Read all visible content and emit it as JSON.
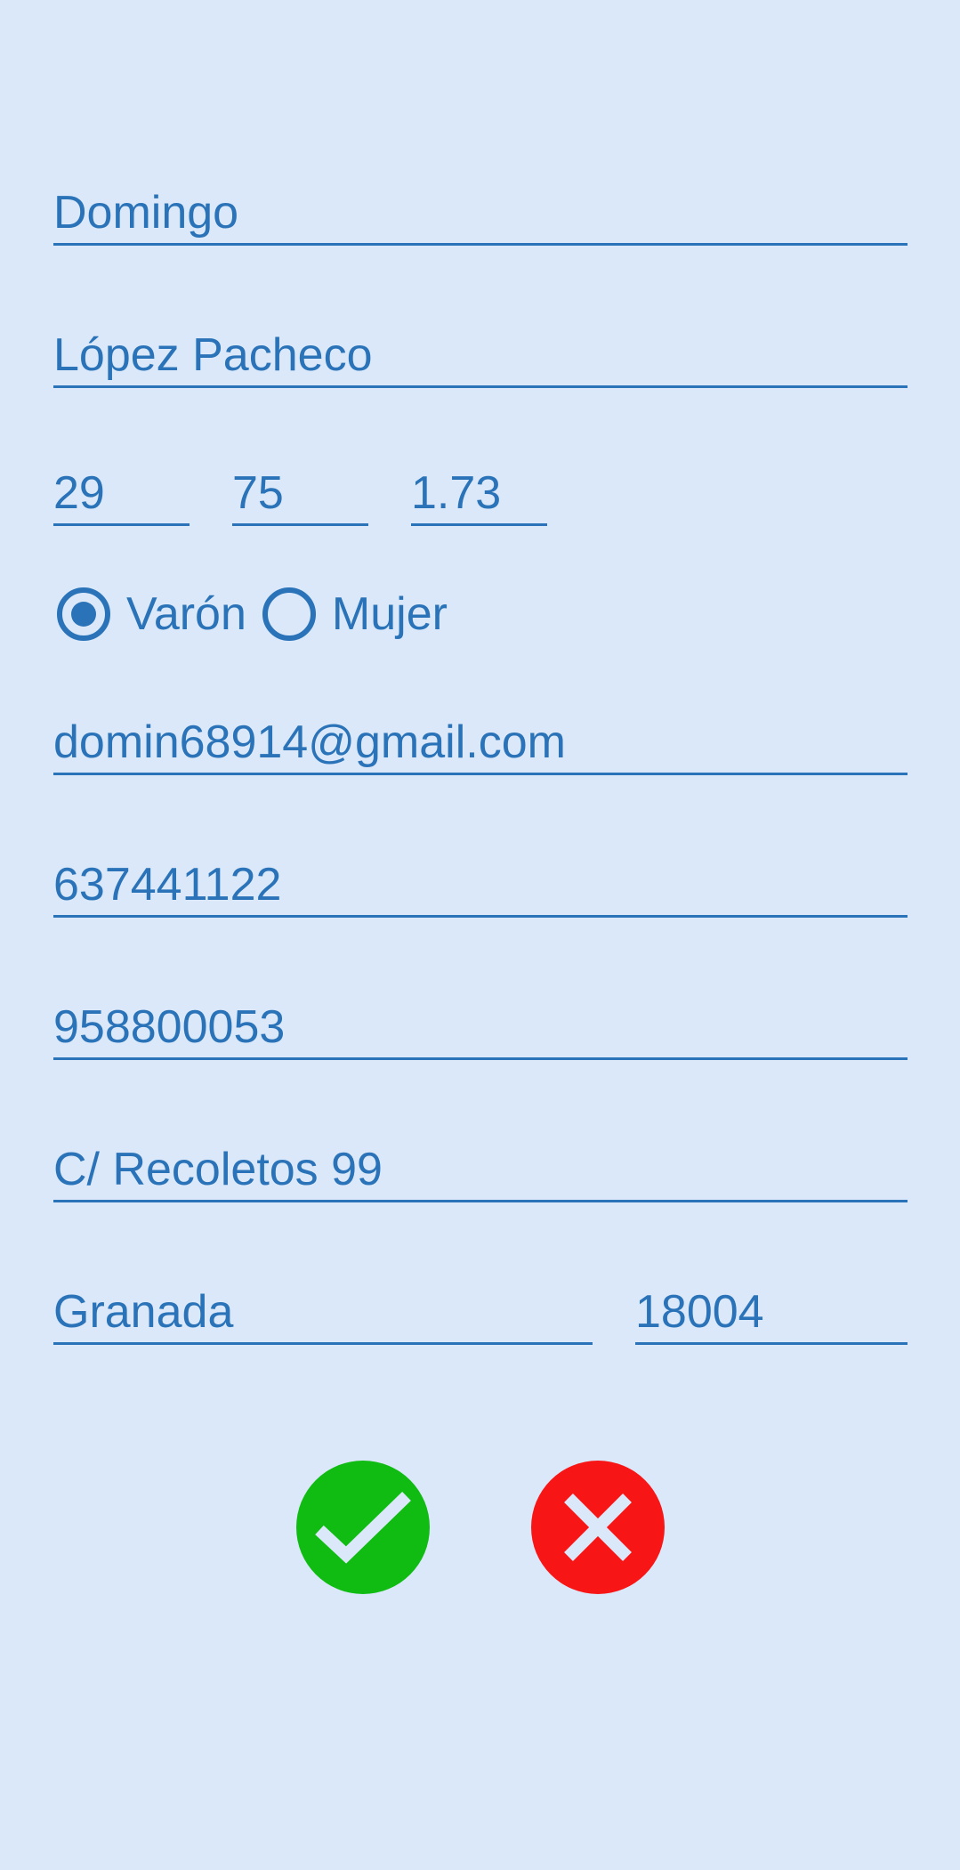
{
  "form": {
    "first_name": "Domingo",
    "last_name": "López Pacheco",
    "age": "29",
    "weight": "75",
    "height": "1.73",
    "gender": {
      "options": [
        {
          "label": "Varón",
          "selected": true
        },
        {
          "label": "Mujer",
          "selected": false
        }
      ]
    },
    "email": "domin68914@gmail.com",
    "mobile_phone": "637441122",
    "landline_phone": "958800053",
    "address": "C/ Recoletos 99",
    "city": "Granada",
    "postal_code": "18004"
  },
  "actions": {
    "confirm_icon": "check-icon",
    "cancel_icon": "close-icon"
  },
  "colors": {
    "background": "#dae8f9",
    "accent": "#2a73b8",
    "confirm": "#10bb12",
    "cancel": "#f81515",
    "icon_stroke": "#dae8f9"
  }
}
